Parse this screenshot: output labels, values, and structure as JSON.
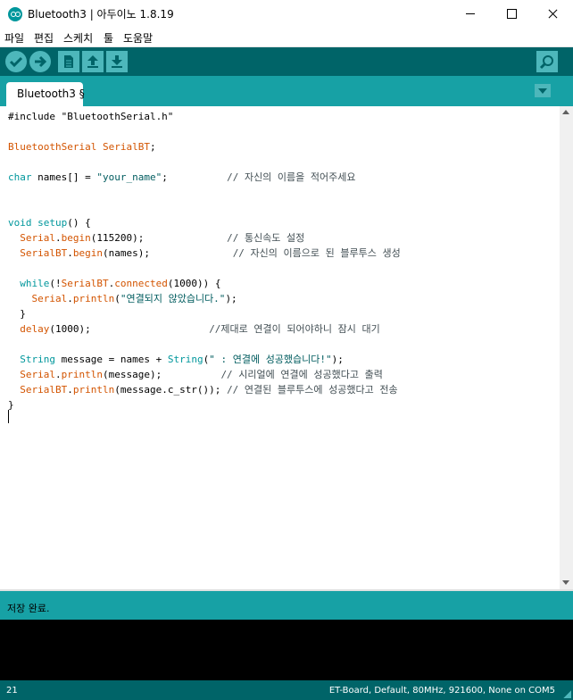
{
  "window": {
    "title": "Bluetooth3 | 아두이노 1.8.19"
  },
  "menu": {
    "items": [
      "파일",
      "편집",
      "스케치",
      "툴",
      "도움말"
    ]
  },
  "toolbar": {
    "buttons": [
      "verify",
      "upload",
      "new",
      "open",
      "save",
      "serial-monitor"
    ]
  },
  "tabs": [
    {
      "label": "Bluetooth3 §"
    }
  ],
  "code": {
    "lines": [
      [
        {
          "t": "#include \"BluetoothSerial.h\"",
          "c": ""
        }
      ],
      [],
      [
        {
          "t": "BluetoothSerial",
          "c": "lib"
        },
        {
          "t": " ",
          "c": ""
        },
        {
          "t": "SerialBT",
          "c": "lib"
        },
        {
          "t": ";",
          "c": ""
        }
      ],
      [],
      [
        {
          "t": "char",
          "c": "kw"
        },
        {
          "t": " names[] = ",
          "c": ""
        },
        {
          "t": "\"your_name\"",
          "c": "str"
        },
        {
          "t": ";          ",
          "c": ""
        },
        {
          "t": "// 자신의 이름을 적어주세요",
          "c": "cm"
        }
      ],
      [],
      [],
      [
        {
          "t": "void",
          "c": "kw"
        },
        {
          "t": " ",
          "c": ""
        },
        {
          "t": "setup",
          "c": "kw"
        },
        {
          "t": "() {",
          "c": ""
        }
      ],
      [
        {
          "t": "  ",
          "c": ""
        },
        {
          "t": "Serial",
          "c": "lib"
        },
        {
          "t": ".",
          "c": ""
        },
        {
          "t": "begin",
          "c": "lib"
        },
        {
          "t": "(115200);              ",
          "c": ""
        },
        {
          "t": "// 통신속도 설정",
          "c": "cm"
        }
      ],
      [
        {
          "t": "  ",
          "c": ""
        },
        {
          "t": "SerialBT",
          "c": "lib"
        },
        {
          "t": ".",
          "c": ""
        },
        {
          "t": "begin",
          "c": "lib"
        },
        {
          "t": "(names);              ",
          "c": ""
        },
        {
          "t": "// 자신의 이름으로 된 블루투스 생성",
          "c": "cm"
        }
      ],
      [],
      [
        {
          "t": "  ",
          "c": ""
        },
        {
          "t": "while",
          "c": "kw"
        },
        {
          "t": "(!",
          "c": ""
        },
        {
          "t": "SerialBT",
          "c": "lib"
        },
        {
          "t": ".",
          "c": ""
        },
        {
          "t": "connected",
          "c": "lib"
        },
        {
          "t": "(1000)) {",
          "c": ""
        }
      ],
      [
        {
          "t": "    ",
          "c": ""
        },
        {
          "t": "Serial",
          "c": "lib"
        },
        {
          "t": ".",
          "c": ""
        },
        {
          "t": "println",
          "c": "lib"
        },
        {
          "t": "(",
          "c": ""
        },
        {
          "t": "\"연결되지 않았습니다.\"",
          "c": "str"
        },
        {
          "t": ");",
          "c": ""
        }
      ],
      [
        {
          "t": "  }",
          "c": ""
        }
      ],
      [
        {
          "t": "  ",
          "c": ""
        },
        {
          "t": "delay",
          "c": "lib"
        },
        {
          "t": "(1000);                    ",
          "c": ""
        },
        {
          "t": "//제대로 연결이 되어야하니 잠시 대기",
          "c": "cm"
        }
      ],
      [],
      [
        {
          "t": "  ",
          "c": ""
        },
        {
          "t": "String",
          "c": "kw"
        },
        {
          "t": " message = names + ",
          "c": ""
        },
        {
          "t": "String",
          "c": "kw"
        },
        {
          "t": "(",
          "c": ""
        },
        {
          "t": "\" : 연결에 성공했습니다!\"",
          "c": "str"
        },
        {
          "t": ");",
          "c": ""
        }
      ],
      [
        {
          "t": "  ",
          "c": ""
        },
        {
          "t": "Serial",
          "c": "lib"
        },
        {
          "t": ".",
          "c": ""
        },
        {
          "t": "println",
          "c": "lib"
        },
        {
          "t": "(message);          ",
          "c": ""
        },
        {
          "t": "// 시리얼에 연결에 성공했다고 출력",
          "c": "cm"
        }
      ],
      [
        {
          "t": "  ",
          "c": ""
        },
        {
          "t": "SerialBT",
          "c": "lib"
        },
        {
          "t": ".",
          "c": ""
        },
        {
          "t": "println",
          "c": "lib"
        },
        {
          "t": "(message.c_str()); ",
          "c": ""
        },
        {
          "t": "// 연결된 블루투스에 성공했다고 전송",
          "c": "cm"
        }
      ],
      [
        {
          "t": "}",
          "c": ""
        }
      ]
    ]
  },
  "status": {
    "message": "저장 완료."
  },
  "footer": {
    "line_number": "21",
    "board": "ET-Board, Default, 80MHz, 921600, None on COM5"
  },
  "colors": {
    "toolbar": "#006468",
    "tabbar": "#17a1a5",
    "keyword": "#00979c",
    "library": "#d35400"
  }
}
